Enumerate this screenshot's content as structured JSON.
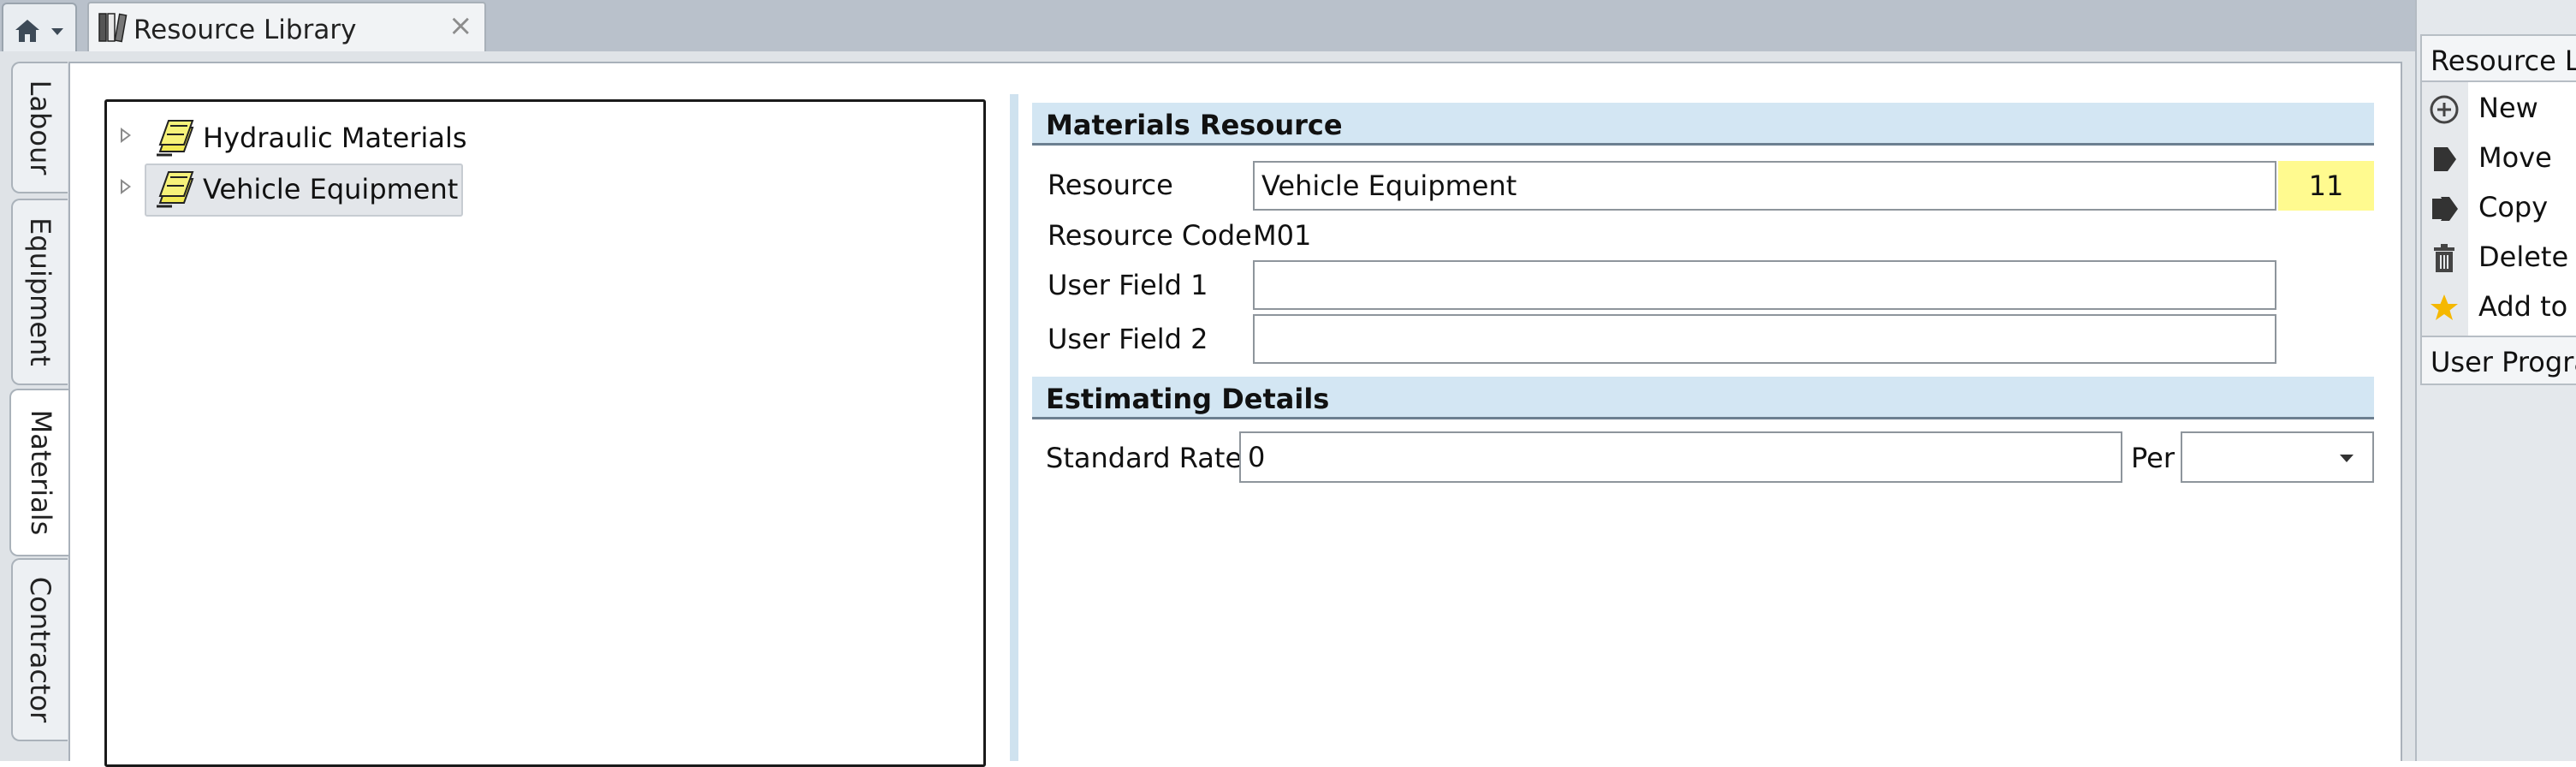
{
  "window": {
    "tab_title": "Resource Library",
    "tab_close": "×"
  },
  "side_tabs": [
    {
      "label": "Labour"
    },
    {
      "label": "Equipment"
    },
    {
      "label": "Materials"
    },
    {
      "label": "Contractor"
    }
  ],
  "active_side_tab": "Materials",
  "tree": {
    "items": [
      {
        "label": "Hydraulic Materials",
        "selected": false
      },
      {
        "label": "Vehicle Equipment",
        "selected": true
      }
    ]
  },
  "materials_resource": {
    "heading": "Materials Resource",
    "resource_label": "Resource",
    "resource_value": "Vehicle Equipment",
    "resource_count": "11",
    "code_label": "Resource Code",
    "code_value": "M01",
    "user_field_1_label": "User Field 1",
    "user_field_1_value": "",
    "user_field_2_label": "User Field 2",
    "user_field_2_value": ""
  },
  "estimating_details": {
    "heading": "Estimating Details",
    "standard_rate_label": "Standard Rate",
    "standard_rate_value": "0",
    "per_label": "Per",
    "per_value": ""
  },
  "right_panel": {
    "header": "Resource L",
    "items": [
      {
        "label": "New",
        "icon": "plus-circle-icon"
      },
      {
        "label": "Move",
        "icon": "move-icon"
      },
      {
        "label": "Copy",
        "icon": "copy-icon"
      },
      {
        "label": "Delete",
        "icon": "trash-icon"
      },
      {
        "label": "Add to",
        "icon": "star-icon"
      }
    ],
    "footer": "User Progra"
  },
  "colors": {
    "section_header_bg": "#d3e6f3",
    "count_highlight": "#fffa8f",
    "star": "#f5b800"
  }
}
